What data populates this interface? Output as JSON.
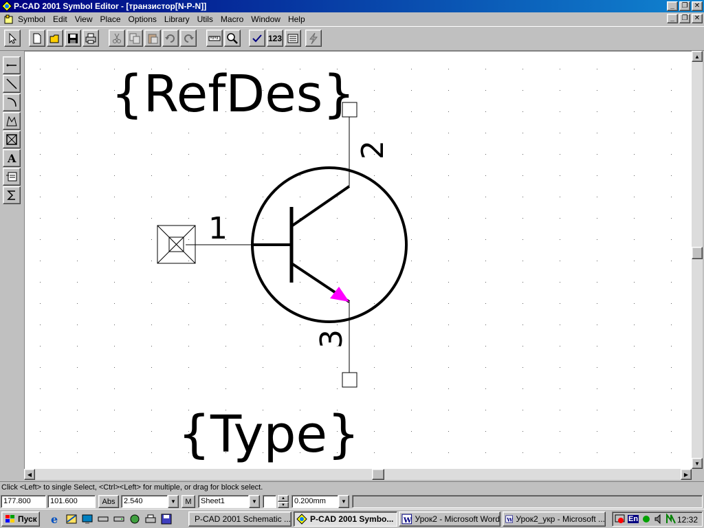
{
  "window": {
    "title": "P-CAD 2001 Symbol Editor - [транзистор[N-P-N]]"
  },
  "menu": {
    "items": [
      "Symbol",
      "Edit",
      "View",
      "Place",
      "Options",
      "Library",
      "Utils",
      "Macro",
      "Window",
      "Help"
    ]
  },
  "toolbar": {
    "select_icon": "pointer-arrow-icon",
    "icons": [
      "new-file-icon",
      "open-folder-icon",
      "save-disk-icon",
      "print-icon",
      "cut-icon",
      "copy-icon",
      "paste-icon",
      "undo-icon",
      "redo-icon",
      "ruler-icon",
      "zoom-icon",
      "validate-checkmark-icon",
      "renumber-icon",
      "attributes-icon",
      "lightning-icon"
    ],
    "renumber_label": "123"
  },
  "left_tools": [
    "place-pin-icon",
    "place-line-icon",
    "place-arc-icon",
    "place-polygon-icon",
    "place-ref-point-icon",
    "place-text-icon",
    "place-attribute-icon",
    "place-ieee-symbol-icon"
  ],
  "drawing": {
    "refdes": "{RefDes}",
    "type": "{Type}",
    "pin_labels": [
      "1",
      "2",
      "3"
    ],
    "emitter_arrow_color": "#ff00ff"
  },
  "status_line": "Click <Left> to single Select, <Ctrl><Left> for multiple, or drag for block select.",
  "statusbar": {
    "x_coord": "177.800",
    "y_coord": "101.600",
    "abs_label": "Abs",
    "grid": "2.540",
    "m_label": "M",
    "sheet": "Sheet1",
    "line_width": "0.200mm"
  },
  "taskbar": {
    "start_label": "Пуск",
    "quick_launch": [
      "ie-icon",
      "outlook-icon",
      "desktop-icon",
      "drive-icon",
      "drive2-icon",
      "network-icon",
      "printer-icon",
      "floppy-icon"
    ],
    "tasks": [
      {
        "label": "P-CAD 2001 Schematic ...",
        "icon": "pcad-icon",
        "active": false
      },
      {
        "label": "P-CAD 2001 Symbo...",
        "icon": "pcad-icon",
        "active": true
      },
      {
        "label": "Урок2 - Microsoft Word",
        "icon": "word-icon",
        "active": false
      },
      {
        "label": "Урок2_укр - Microsoft ...",
        "icon": "word-icon",
        "active": false
      }
    ],
    "tray_lang": "En",
    "clock": "12:32"
  }
}
